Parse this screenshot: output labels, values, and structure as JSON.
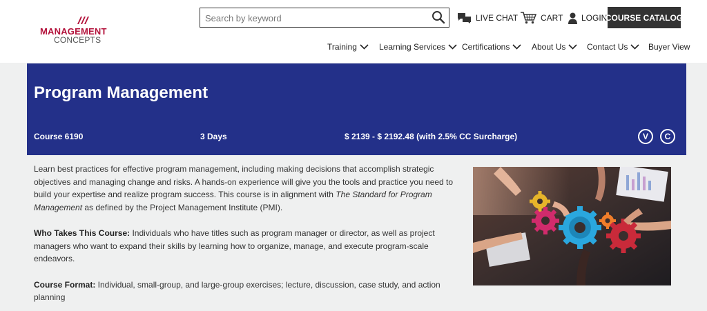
{
  "header": {
    "logo_line1": "MANAGEMENT",
    "logo_line2": "CONCEPTS",
    "search_placeholder": "Search by keyword",
    "live_chat": "LIVE CHAT",
    "cart": "CART",
    "login": "LOGIN",
    "course_catalog": "COURSE CATALOG"
  },
  "nav": {
    "items": [
      {
        "label": "Training"
      },
      {
        "label": "Learning Services"
      },
      {
        "label": "Certifications"
      },
      {
        "label": "About Us"
      },
      {
        "label": "Contact Us"
      },
      {
        "label": "Buyer View"
      }
    ]
  },
  "course": {
    "title": "Program Management",
    "number": "Course 6190",
    "duration": "3 Days",
    "price": "$ 2139 - $ 2192.48 (with 2.5% CC Surcharge)",
    "badge_v": "V",
    "badge_c": "C"
  },
  "description": {
    "intro": "Learn best practices for effective program management, including making decisions that accomplish strategic objectives and managing change and risks. A hands-on experience will give you the tools and practice you need to build your expertise and realize program success. This course is in alignment with ",
    "intro_italic": "The Standard for Program Management",
    "intro_end": " as defined by the Project Management Institute (PMI).",
    "who_label": "Who Takes This Course:",
    "who_text": " Individuals who have titles such as program manager or director, as well as project managers who want to expand their skills by learning how to organize, manage, and execute program-scale endeavors.",
    "format_label": "Course Format:",
    "format_text": " Individual, small-group, and large-group exercises; lecture, discussion, case study, and action planning"
  },
  "colors": {
    "banner": "#233089",
    "brand_red": "#b3123b",
    "catalog_bg": "#333333",
    "page_bg": "#eff0f0"
  }
}
